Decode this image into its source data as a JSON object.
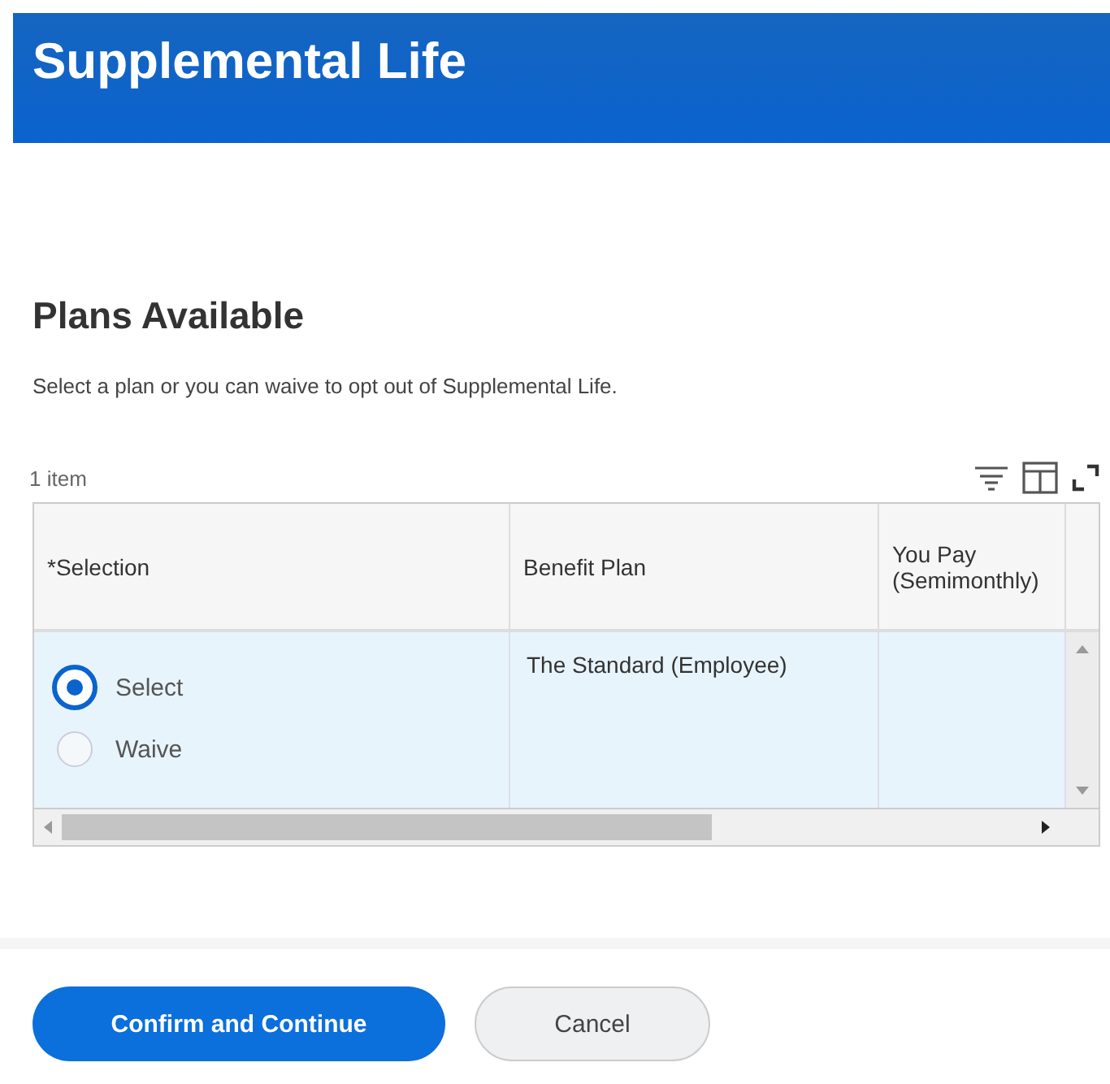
{
  "header": {
    "title": "Supplemental Life"
  },
  "section": {
    "title": "Plans Available",
    "description": "Select a plan or you can waive to opt out of Supplemental Life."
  },
  "table": {
    "count": "1 item",
    "columns": [
      "*Selection",
      "Benefit Plan",
      "You Pay (Semimonthly)"
    ],
    "rows": [
      {
        "options": [
          {
            "label": "Select",
            "selected": true
          },
          {
            "label": "Waive",
            "selected": false
          }
        ],
        "benefit_plan": "The Standard  (Employee)"
      }
    ]
  },
  "buttons": [
    {
      "label": "Confirm and Continue",
      "kind": "primary"
    },
    {
      "label": "Cancel",
      "kind": "secondary"
    }
  ]
}
